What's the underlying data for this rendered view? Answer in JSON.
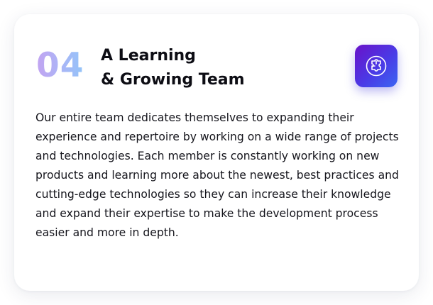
{
  "card": {
    "number": "04",
    "title_line1": "A Learning",
    "title_line2": "& Growing Team",
    "icon": "puzzle-icon",
    "body": "Our entire team dedicates themselves to expanding their experience and repertoire by working on a wide range of projects and technologies. Each member is constantly working on new products and learning more about the newest, best practices and cutting-edge technologies so they can increase their knowledge and expand their expertise to make the development process easier and more in depth."
  },
  "colors": {
    "icon_gradient_start": "#6a12c9",
    "icon_gradient_end": "#3c66f2",
    "number_gradient_start": "#c3a4f1",
    "number_gradient_end": "#93c4f8",
    "text": "#15151c"
  }
}
